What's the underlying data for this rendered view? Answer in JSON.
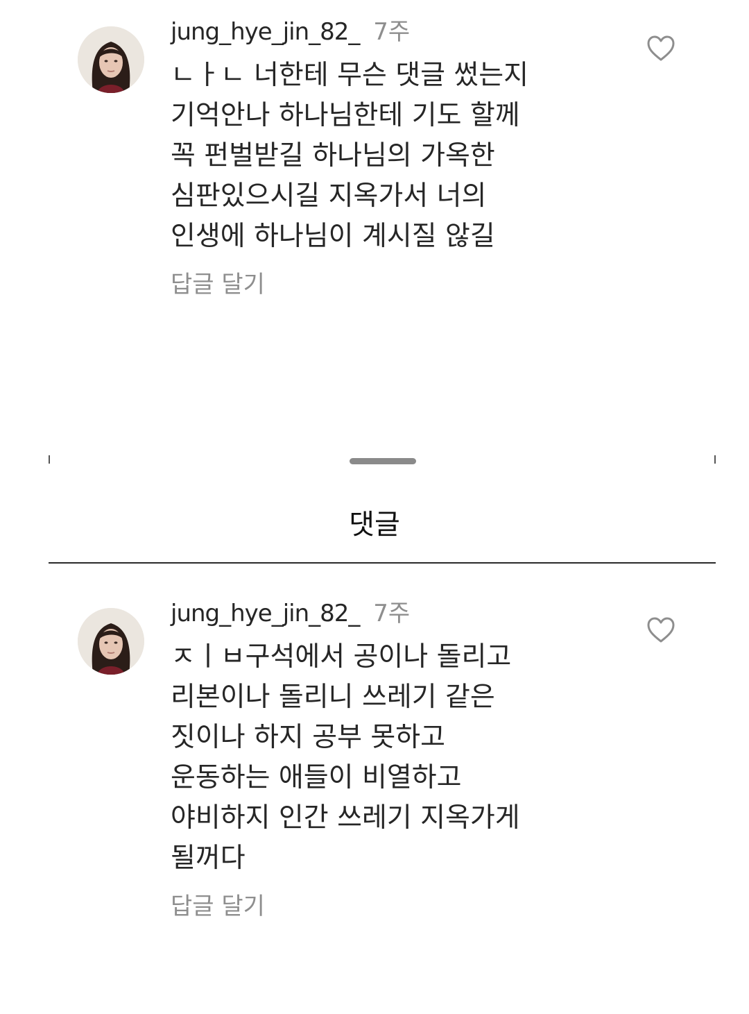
{
  "comments": [
    {
      "username": "jung_hye_jin_82_",
      "time": "7주",
      "lines": [
        "ㄴㅏㄴ 너한테 무슨 댓글 썼는지",
        "기억안나 하나님한테 기도 할께",
        "꼭 펀벌받길 하나님의 가옥한",
        "심판있으시길 지옥가서 너의",
        "인생에 하나님이 계시질 않길"
      ],
      "reply_label": "답글 달기",
      "like_icon": "heart-outline-icon"
    },
    {
      "username": "jung_hye_jin_82_",
      "time": "7주",
      "lines": [
        "ㅈㅣㅂ구석에서 공이나 돌리고",
        "리본이나 돌리니 쓰레기 같은",
        "짓이나 하지 공부 못하고",
        "운동하는 애들이 비열하고",
        "야비하지 인간 쓰레기 지옥가게",
        "될꺼다"
      ],
      "reply_label": "답글 달기",
      "like_icon": "heart-outline-icon"
    }
  ],
  "sheet": {
    "title": "댓글"
  },
  "colors": {
    "text": "#262626",
    "secondary": "#8e8e8e",
    "divider": "#2a2a2a",
    "background": "#ffffff"
  }
}
